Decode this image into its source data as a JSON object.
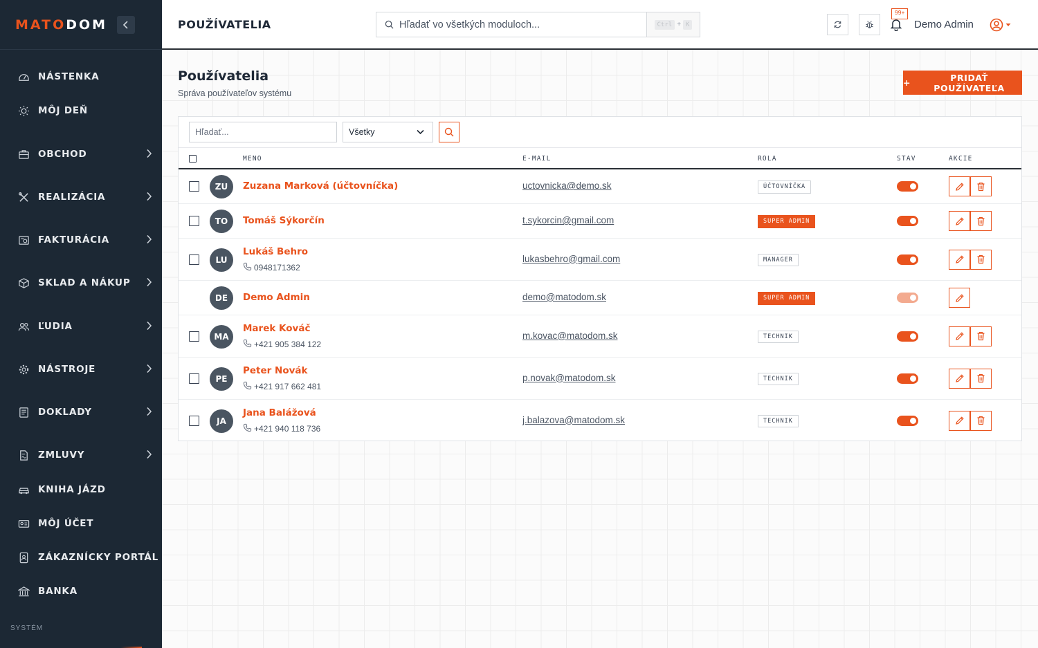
{
  "brand": {
    "part1": "MATO",
    "part2": "DOM"
  },
  "sidebar": {
    "items": [
      {
        "label": "NÁSTENKA",
        "icon": "gauge-icon",
        "has_children": false
      },
      {
        "label": "MÔJ DEŇ",
        "icon": "sun-icon",
        "has_children": false
      },
      {
        "label": "OBCHOD",
        "icon": "briefcase-icon",
        "has_children": true
      },
      {
        "label": "REALIZÁCIA",
        "icon": "tools-icon",
        "has_children": true
      },
      {
        "label": "FAKTURÁCIA",
        "icon": "invoice-icon",
        "has_children": true
      },
      {
        "label": "SKLAD A NÁKUP",
        "icon": "box-icon",
        "has_children": true
      },
      {
        "label": "ĽUDIA",
        "icon": "users-icon",
        "has_children": true
      },
      {
        "label": "NÁSTROJE",
        "icon": "gear-icon",
        "has_children": true
      },
      {
        "label": "DOKLADY",
        "icon": "document-icon",
        "has_children": true
      },
      {
        "label": "ZMLUVY",
        "icon": "contract-icon",
        "has_children": true
      },
      {
        "label": "KNIHA JÁZD",
        "icon": "car-icon",
        "has_children": false
      },
      {
        "label": "MÔJ ÚČET",
        "icon": "id-card-icon",
        "has_children": false
      },
      {
        "label": "ZÁKAZNÍCKY PORTÁL",
        "icon": "portal-icon",
        "has_children": false
      },
      {
        "label": "BANKA",
        "icon": "bank-icon",
        "has_children": false
      }
    ],
    "section_label": "SYSTÉM"
  },
  "topbar": {
    "page_title": "POUŽÍVATELIA",
    "search_placeholder": "Hľadať vo všetkých moduloch...",
    "shortcut_key1": "Ctrl",
    "shortcut_key2": "K",
    "notification_badge": "99+",
    "user_name": "Demo Admin"
  },
  "page": {
    "title": "Používatelia",
    "subtitle": "Správa používateľov systému",
    "add_button": "PRIDAŤ POUŽÍVATEĽA"
  },
  "filters": {
    "search_placeholder": "Hľadať...",
    "status_value": "Všetky"
  },
  "table": {
    "columns": {
      "name": "MENO",
      "email": "E-MAIL",
      "role": "ROLA",
      "status": "STAV",
      "actions": "AKCIE"
    },
    "rows": [
      {
        "initials": "ZU",
        "name": "Zuzana Marková (účtovníčka)",
        "phone": "",
        "email": "uctovnicka@demo.sk",
        "role": "ÚČTOVNÍČKA",
        "role_style": "outline",
        "active": true,
        "can_delete": true,
        "selectable": true
      },
      {
        "initials": "TO",
        "name": "Tomáš Sýkorčín",
        "phone": "",
        "email": "t.sykorcin@gmail.com",
        "role": "SUPER ADMIN",
        "role_style": "filled",
        "active": true,
        "can_delete": true,
        "selectable": true
      },
      {
        "initials": "LU",
        "name": "Lukáš Behro",
        "phone": "0948171362",
        "email": "lukasbehro@gmail.com",
        "role": "MANAGER",
        "role_style": "outline",
        "active": true,
        "can_delete": true,
        "selectable": true
      },
      {
        "initials": "DE",
        "name": "Demo Admin",
        "phone": "",
        "email": "demo@matodom.sk",
        "role": "SUPER ADMIN",
        "role_style": "filled",
        "active": true,
        "toggle_disabled": true,
        "can_delete": false,
        "selectable": false
      },
      {
        "initials": "MA",
        "name": "Marek Kováč",
        "phone": "+421 905 384 122",
        "email": "m.kovac@matodom.sk",
        "role": "TECHNIK",
        "role_style": "outline",
        "active": true,
        "can_delete": true,
        "selectable": true
      },
      {
        "initials": "PE",
        "name": "Peter Novák",
        "phone": "+421 917 662 481",
        "email": "p.novak@matodom.sk",
        "role": "TECHNIK",
        "role_style": "outline",
        "active": true,
        "can_delete": true,
        "selectable": true
      },
      {
        "initials": "JA",
        "name": "Jana Balážová",
        "phone": "+421 940 118 736",
        "email": "j.balazova@matodom.sk",
        "role": "TECHNIK",
        "role_style": "outline",
        "active": true,
        "can_delete": true,
        "selectable": true
      }
    ]
  },
  "colors": {
    "accent": "#e9531d",
    "sidebar_bg": "#1c2834",
    "avatar_bg": "#4a5561"
  }
}
